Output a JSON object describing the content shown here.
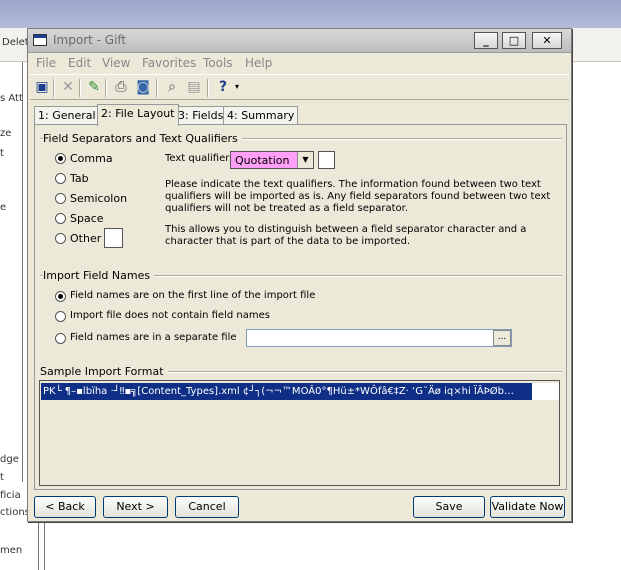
{
  "window": {
    "title": "Import - Gift"
  },
  "background": {
    "top_fragment": "Delet",
    "left_fragments": [
      "s Att",
      "ze",
      "t",
      "e",
      "dge",
      "t",
      "ficia",
      "ctions",
      "men"
    ]
  },
  "menu": [
    "File",
    "Edit",
    "View",
    "Favorites",
    "Tools",
    "Help"
  ],
  "toolbar_icons": [
    "save-icon",
    "delete-icon",
    "wizard-icon",
    "print-icon",
    "print-preview-icon",
    "find-icon",
    "properties-icon",
    "help-icon",
    "dropdown-icon"
  ],
  "tabs": [
    {
      "label": "1: General"
    },
    {
      "label": "2: File Layout"
    },
    {
      "label": "3: Fields"
    },
    {
      "label": "4: Summary"
    }
  ],
  "separators": {
    "title": "Field Separators and Text Qualifiers",
    "options": [
      "Comma",
      "Tab",
      "Semicolon",
      "Space",
      "Other"
    ],
    "selected": "Comma",
    "qualifier_label": "Text qualifier:",
    "qualifier_value": "Quotation",
    "info1": "Please indicate the text qualifiers.  The information found between two text qualifiers will be imported as is.  Any field separators found between two text qualifiers will not be treated as a field separator.",
    "info2": "This allows you to distinguish between a field separator character and a character that is part of the data to be imported."
  },
  "field_names": {
    "title": "Import Field Names",
    "options": [
      "Field names are on the first line of the import file",
      "Import file does not contain field names",
      "Field names are in a separate file"
    ],
    "selected": 0,
    "browse_label": "..."
  },
  "sample": {
    "title": "Sample Import Format",
    "line": "PK└ ¶–▪lbïha   ·┘‼▪╗[Content_Types].xml ¢┘┐(¬¬™MOÂ0°¶Hü±*WÔfâ€‡Z· ‘G˜Äø   iq×hi ÏÂÞØb…"
  },
  "buttons": {
    "back": "< Back",
    "next": "Next >",
    "cancel": "Cancel",
    "save": "Save",
    "validate": "Validate Now"
  },
  "colors": {
    "qualifier_bg": "#ff9ff7",
    "selection_bg": "#0f2f86",
    "window_bg": "#ece9d8"
  }
}
